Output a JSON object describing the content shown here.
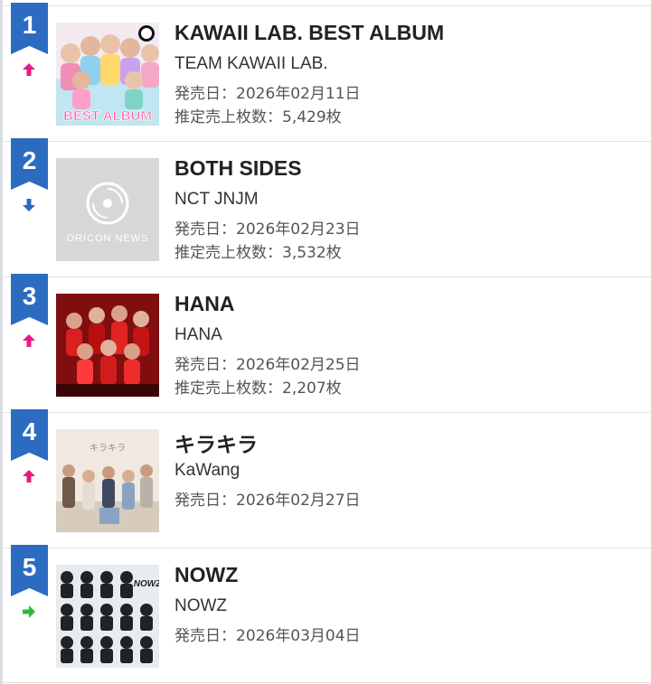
{
  "colors": {
    "ribbon": "#2b6cc0",
    "trend_up": "#e8197f",
    "trend_down": "#2b6cc0",
    "trend_same": "#2dbb3f"
  },
  "ranking": [
    {
      "rank": "1",
      "trend": "up",
      "trend_icon": "arrow-up-icon",
      "title": "KAWAII LAB. BEST ALBUM",
      "artist": "TEAM KAWAII LAB.",
      "release": "発売日：2026年02月11日",
      "sales": "推定売上枚数：5,429枚",
      "cover_text": "BEST ALBUM"
    },
    {
      "rank": "2",
      "trend": "down",
      "trend_icon": "arrow-down-icon",
      "title": "BOTH SIDES",
      "artist": "NCT JNJM",
      "release": "発売日：2026年02月23日",
      "sales": "推定売上枚数：3,532枚",
      "cover_text": "ORICON NEWS"
    },
    {
      "rank": "3",
      "trend": "up",
      "trend_icon": "arrow-up-icon",
      "title": "HANA",
      "artist": "HANA",
      "release": "発売日：2026年02月25日",
      "sales": "推定売上枚数：2,207枚"
    },
    {
      "rank": "4",
      "trend": "up",
      "trend_icon": "arrow-up-icon",
      "title": "キラキラ",
      "artist": "KaWang",
      "release": "発売日：2026年02月27日",
      "cover_text": "キラキラ"
    },
    {
      "rank": "5",
      "trend": "same",
      "trend_icon": "arrow-right-icon",
      "title": "NOWZ",
      "artist": "NOWZ",
      "release": "発売日：2026年03月04日",
      "cover_text": "NOWZ"
    }
  ]
}
